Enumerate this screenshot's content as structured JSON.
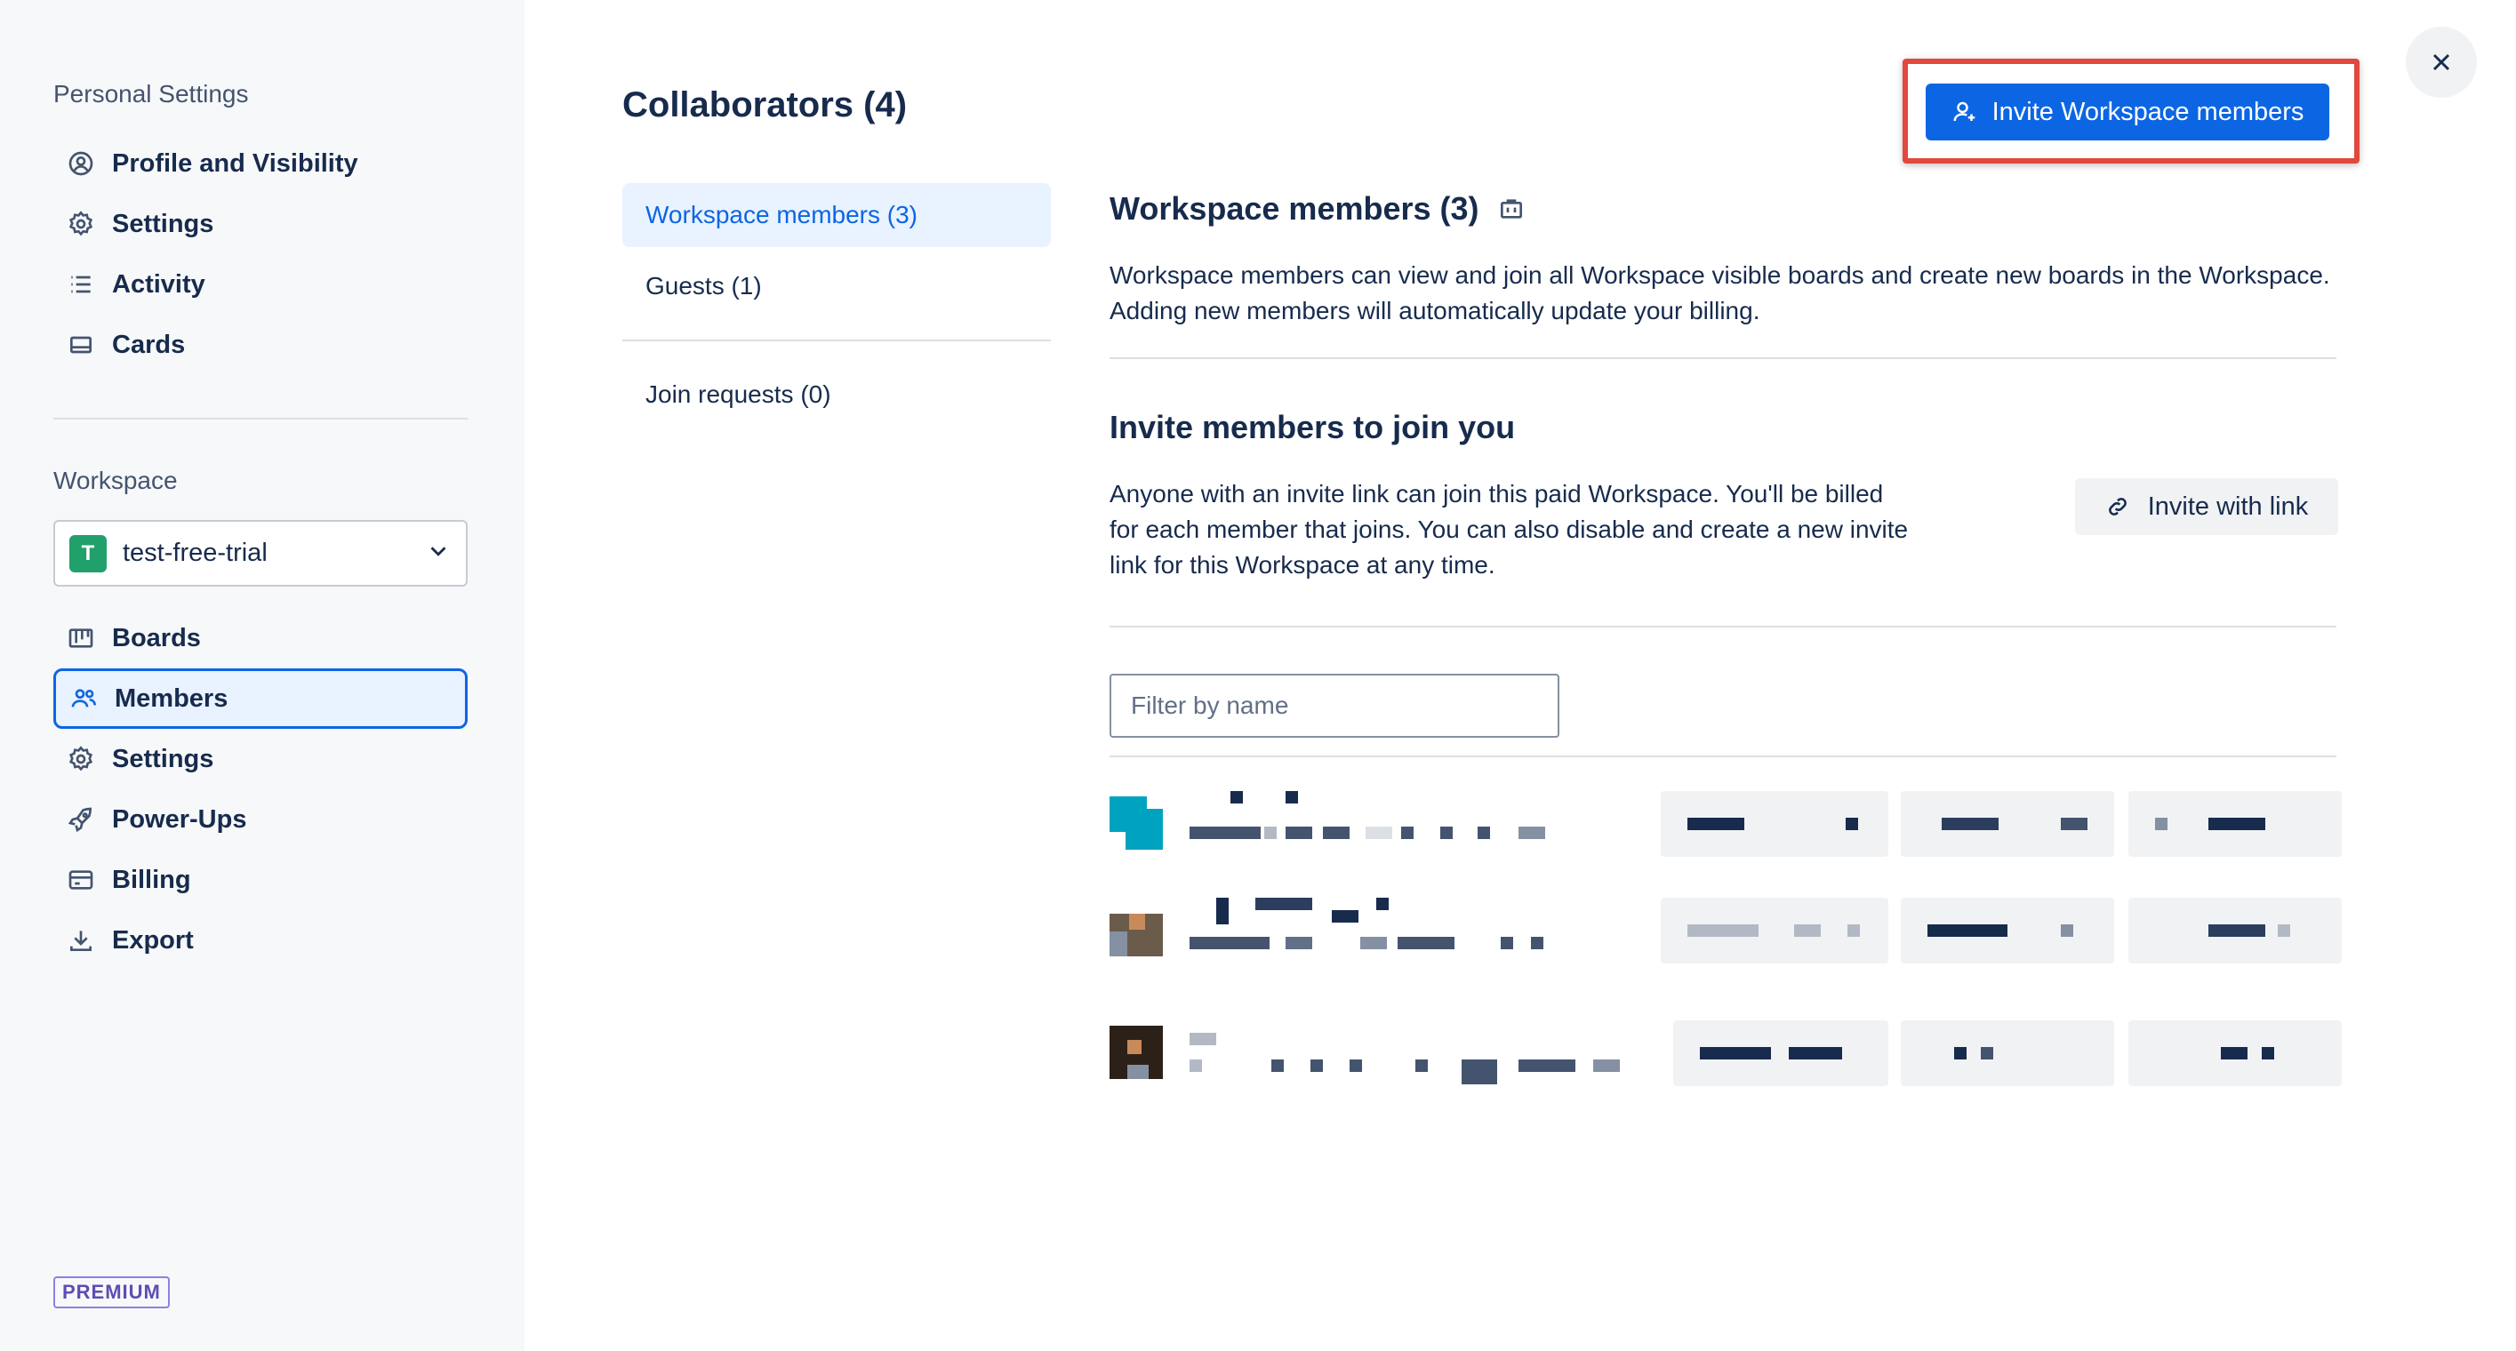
{
  "sidebar": {
    "personal_title": "Personal Settings",
    "personal_items": [
      {
        "label": "Profile and Visibility",
        "icon": "user-circle-icon"
      },
      {
        "label": "Settings",
        "icon": "gear-icon"
      },
      {
        "label": "Activity",
        "icon": "list-icon"
      },
      {
        "label": "Cards",
        "icon": "card-icon"
      }
    ],
    "workspace_title": "Workspace",
    "workspace": {
      "initial": "T",
      "name": "test-free-trial"
    },
    "workspace_items": [
      {
        "label": "Boards",
        "icon": "board-icon"
      },
      {
        "label": "Members",
        "icon": "people-icon",
        "active": true
      },
      {
        "label": "Settings",
        "icon": "gear-icon"
      },
      {
        "label": "Power-Ups",
        "icon": "rocket-icon"
      },
      {
        "label": "Billing",
        "icon": "credit-card-icon"
      },
      {
        "label": "Export",
        "icon": "download-icon"
      }
    ],
    "plan_badge": "PREMIUM"
  },
  "main": {
    "title": "Collaborators (4)",
    "invite_button": "Invite Workspace members",
    "tabs": [
      {
        "label": "Workspace members (3)",
        "active": true
      },
      {
        "label": "Guests (1)"
      },
      {
        "label": "Join requests (0)"
      }
    ],
    "members_section": {
      "heading": "Workspace members (3)",
      "description": "Workspace members can view and join all Workspace visible boards and create new boards in the Workspace. Adding new members will automatically update your billing."
    },
    "invite_section": {
      "heading": "Invite members to join you",
      "description": "Anyone with an invite link can join this paid Workspace. You'll be billed for each member that joins. You can also disable and create a new invite link for this Workspace at any time.",
      "invite_link_button": "Invite with link"
    },
    "filter": {
      "placeholder": "Filter by name",
      "value": ""
    }
  },
  "colors": {
    "accent": "#0c66e4",
    "highlight": "#e2483d",
    "workspace_avatar": "#22a06b"
  }
}
